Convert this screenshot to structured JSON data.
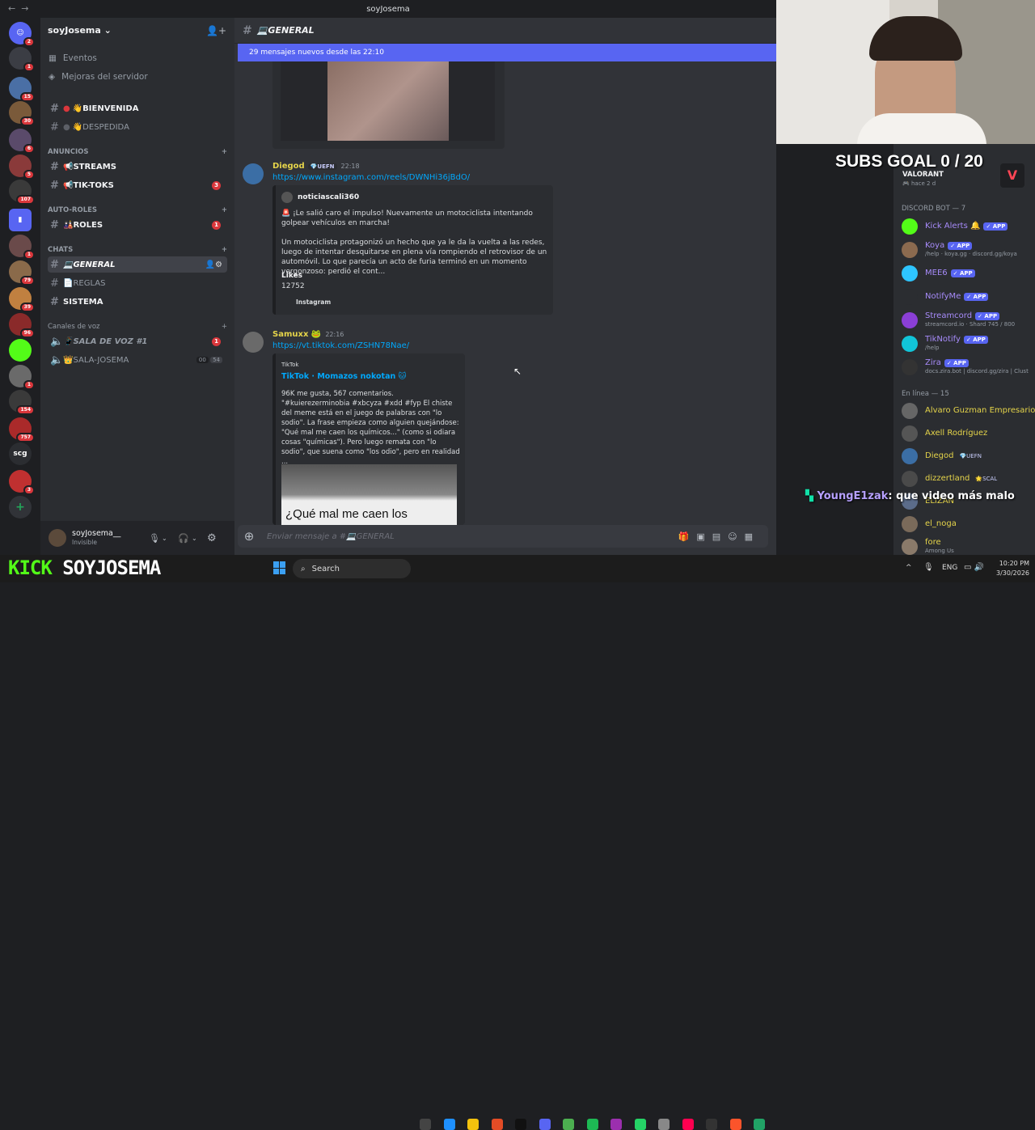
{
  "window": {
    "title": "soyJosema"
  },
  "server": {
    "name": "soyJosema ⌄"
  },
  "sidebar": {
    "events": "Eventos",
    "boosts": "Mejoras del servidor",
    "channels_top": [
      {
        "label": "👋BIENVENIDA",
        "icon": "red-dot"
      },
      {
        "label": "👋DESPEDIDA",
        "icon": "gray-dot"
      }
    ],
    "categories": {
      "anuncios": "ANUNCIOS",
      "autoroles": "AUTO-ROLES",
      "chats": "CHATS",
      "voz": "Canales de voz"
    },
    "anuncios": [
      {
        "label": "📢STREAMS",
        "count": ""
      },
      {
        "label": "📢TIK-TOKS",
        "count": "3"
      }
    ],
    "autoroles": [
      {
        "label": "🎎ROLES",
        "count": "1"
      }
    ],
    "chats": [
      {
        "label": "💻GENERAL"
      },
      {
        "label": "📄REGLAS"
      },
      {
        "label": "SISTEMA"
      }
    ],
    "voice": [
      {
        "label": "📱SALA DE VOZ #1",
        "count": "1"
      },
      {
        "label": "👑SALA-JOSEMA",
        "a": "00",
        "b": "54"
      }
    ]
  },
  "guild_badges": [
    "2",
    "1",
    "15",
    "30",
    "6",
    "5",
    "107",
    "",
    "1",
    "79",
    "39",
    "96",
    "",
    "1",
    "154",
    "757",
    "",
    "3"
  ],
  "guild_text": {
    "scg": "scg"
  },
  "user": {
    "name": "soyJosema__",
    "status": "Invisible"
  },
  "chat": {
    "channel": "💻GENERAL",
    "new_banner": "29 mensajes nuevos desde las 22:10",
    "messages": [
      {
        "author": "Diegod",
        "tag": "💎UEFN",
        "time": "22:18",
        "link": "https://www.instagram.com/reels/DWNHi36jBdO/",
        "embed": {
          "author": "noticiascali360",
          "text1": "🚨 ¡Le salió caro el impulso! Nuevamente un motociclista intentando golpear vehículos en marcha!",
          "text2": "Un motociclista protagonizó un hecho que ya le da la vuelta a las redes, luego de intentar desquitarse en plena vía rompiendo el retrovisor de un automóvil. Lo que parecía un acto de furia terminó en un momento vergonzoso: perdió el cont...",
          "field_name": "Likes",
          "field_value": "12752",
          "footer": "Instagram"
        }
      },
      {
        "author": "Samuxx",
        "tag": "🐸",
        "time": "22:16",
        "link": "https://vt.tiktok.com/ZSHN78Nae/",
        "embed": {
          "provider": "TikTok",
          "title": "TikTok · Momazos nokotan 🐱",
          "text": "96K me gusta, 567 comentarios. \"#kuierezerminobia #xbcyza #xdd #fyp El chiste del meme está en el juego de palabras con \"lo sodio\". La frase empieza como alguien quejándose: \"Qué mal me caen los químicos...\" (como si odiara cosas \"químicas\"). Pero luego remata con \"lo sodio\", que suena como \"los odio\", pero en realidad ...",
          "thumb_text": "¿Qué mal me caen los"
        }
      }
    ],
    "composer_placeholder": "Enviar mensaje a #💻GENERAL"
  },
  "members": {
    "game": {
      "title": "VALORANT",
      "sub": "🎮 hace 2 d"
    },
    "bot_cat": "DISCORD BOT — 7",
    "bots": [
      {
        "name": "Kick Alerts 🔔",
        "sub": "",
        "color": "#53fc18"
      },
      {
        "name": "Koya",
        "sub": "/help · koya.gg · discord.gg/koya",
        "color": "#8b6a4f"
      },
      {
        "name": "MEE6",
        "sub": "",
        "color": "#2ec5ff"
      },
      {
        "name": "NotifyMe",
        "sub": "",
        "color": "#2b2d31"
      },
      {
        "name": "Streamcord",
        "sub": "streamcord.io · Shard 745 / 800",
        "color": "#8b3fd6"
      },
      {
        "name": "TikNotify",
        "sub": "/help",
        "color": "#11c5d9"
      },
      {
        "name": "Zira",
        "sub": "docs.zira.bot | discord.gg/zira | Clust",
        "color": "#333"
      }
    ],
    "app_label": "✓ APP",
    "online_cat": "En línea — 15",
    "online": [
      {
        "name": "Alvaro Guzman Empresario",
        "sub": "",
        "color": "#666"
      },
      {
        "name": "Axell Rodríguez",
        "sub": "",
        "color": "#555"
      },
      {
        "name": "Diegod",
        "tag": "💎UEFN",
        "sub": "",
        "color": "#3b6ea5"
      },
      {
        "name": "dizzertland",
        "tag": "🌟SCAL",
        "sub": "",
        "color": "#4a4a4a"
      },
      {
        "name": "ELIZAN",
        "sub": "",
        "color": "#5b6c8a"
      },
      {
        "name": "el_noga",
        "sub": "",
        "color": "#7a6a5a"
      },
      {
        "name": "fore",
        "sub": "Among Us",
        "color": "#8a7a6a"
      }
    ]
  },
  "overlay": {
    "subs_goal": "SUBS GOAL 0 / 20",
    "chat_user": "YoungE1zak",
    "chat_msg": ": que video más malo",
    "kick_brand": "KICK",
    "kick_name": "SOYJOSEMA"
  },
  "taskbar": {
    "search": "Search",
    "lang": "ENG",
    "time": "10:20 PM",
    "date": "3/30/2026"
  }
}
